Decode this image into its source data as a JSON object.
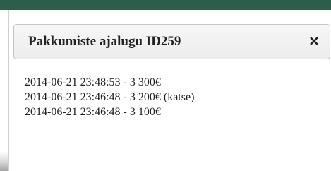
{
  "dialog": {
    "title": "Pakkumiste ajalugu ID259",
    "close_icon": "close-icon"
  },
  "history": [
    {
      "text": "2014-06-21 23:48:53 - 3 300€"
    },
    {
      "text": "2014-06-21 23:46:48 - 3 200€ (katse)"
    },
    {
      "text": "2014-06-21 23:46:48 - 3 100€"
    }
  ],
  "colors": {
    "top_strip": "#2f5d4c",
    "titlebar": "#ececec",
    "text": "#222222"
  }
}
